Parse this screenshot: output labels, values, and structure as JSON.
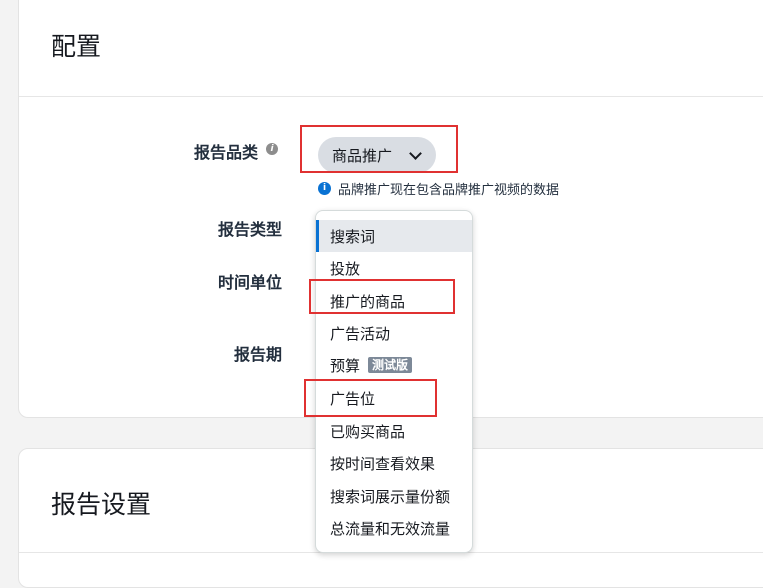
{
  "config": {
    "title": "配置",
    "report_category": {
      "label": "报告品类",
      "info_icon": "i",
      "selected": "商品推广",
      "hint_icon": "i",
      "hint": "品牌推广现在包含品牌推广视频的数据"
    },
    "report_type_label": "报告类型",
    "time_unit_label": "时间单位",
    "report_period_label": "报告期"
  },
  "dropdown": {
    "options": [
      {
        "label": "搜索词",
        "active": true
      },
      {
        "label": "投放"
      },
      {
        "label": "推广的商品"
      },
      {
        "label": "广告活动"
      },
      {
        "label": "预算",
        "badge": "测试版"
      },
      {
        "label": "广告位"
      },
      {
        "label": "已购买商品"
      },
      {
        "label": "按时间查看效果"
      },
      {
        "label": "搜索词展示量份额"
      },
      {
        "label": "总流量和无效流量"
      }
    ]
  },
  "settings": {
    "title": "报告设置"
  },
  "colors": {
    "accent": "#0972d3",
    "highlight": "#e03131"
  }
}
